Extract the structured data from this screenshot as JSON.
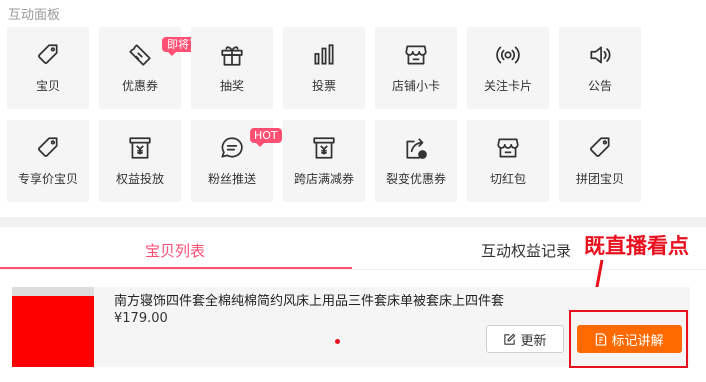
{
  "panel": {
    "title": "互动面板"
  },
  "tiles": [
    {
      "label": "宝贝",
      "icon": "tag-icon"
    },
    {
      "label": "优惠券",
      "icon": "coupon-icon",
      "badge": "即将下线"
    },
    {
      "label": "抽奖",
      "icon": "gift-icon"
    },
    {
      "label": "投票",
      "icon": "bar-chart-icon"
    },
    {
      "label": "店铺小卡",
      "icon": "store-icon"
    },
    {
      "label": "关注卡片",
      "icon": "broadcast-icon"
    },
    {
      "label": "公告",
      "icon": "speaker-icon"
    },
    {
      "label": "专享价宝贝",
      "icon": "tag-icon"
    },
    {
      "label": "权益投放",
      "icon": "yen-box-icon"
    },
    {
      "label": "粉丝推送",
      "icon": "chat-bubble-icon",
      "badge": "HOT"
    },
    {
      "label": "跨店满减券",
      "icon": "yen-box-icon"
    },
    {
      "label": "裂变优惠券",
      "icon": "share-coupon-icon"
    },
    {
      "label": "切红包",
      "icon": "store-icon"
    },
    {
      "label": "拼团宝贝",
      "icon": "tag-icon"
    }
  ],
  "tabs": {
    "active": "宝贝列表",
    "inactive": "互动权益记录"
  },
  "annotation": {
    "text": "既直播看点"
  },
  "product": {
    "title": "南方寝饰四件套全棉纯棉简约风床上用品三件套床单被套床上四件套",
    "price": "¥179.00"
  },
  "buttons": {
    "update": "更新",
    "mark": "标记讲解"
  },
  "colors": {
    "accent": "#ff4f73",
    "orange": "#ff6a00",
    "annotation": "#e8101e"
  }
}
